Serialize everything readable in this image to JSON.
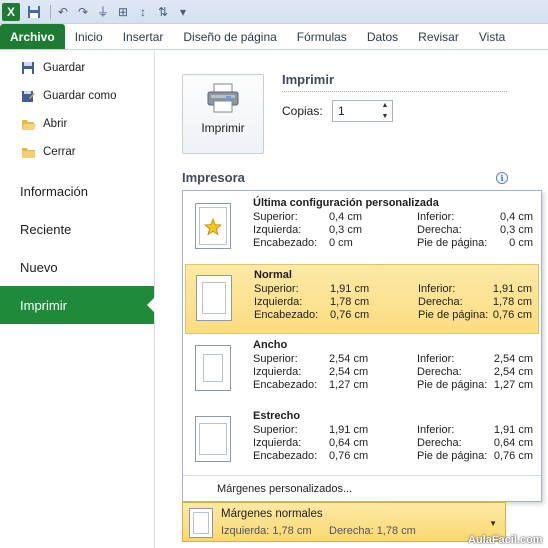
{
  "ribbon": {
    "file_tab": "Archivo",
    "tabs": [
      "Inicio",
      "Insertar",
      "Diseño de página",
      "Fórmulas",
      "Datos",
      "Revisar",
      "Vista"
    ]
  },
  "nav": {
    "commands": [
      {
        "label": "Guardar",
        "icon": "floppy-disk-icon"
      },
      {
        "label": "Guardar como",
        "icon": "save-as-icon"
      },
      {
        "label": "Abrir",
        "icon": "open-folder-icon"
      },
      {
        "label": "Cerrar",
        "icon": "close-folder-icon"
      }
    ],
    "tabs": [
      "Información",
      "Reciente",
      "Nuevo",
      "Imprimir"
    ],
    "active_tab": "Imprimir"
  },
  "print": {
    "button_label": "Imprimir",
    "title": "Imprimir",
    "copies_label": "Copias:",
    "copies_value": "1"
  },
  "printer_section": "Impresora",
  "margins": {
    "options": [
      {
        "name": "Última configuración personalizada",
        "superior": "0,4 cm",
        "inferior": "0,4 cm",
        "izquierda": "0,3 cm",
        "derecha": "0,3 cm",
        "encabezado": "0 cm",
        "pie": "0 cm",
        "selected": false
      },
      {
        "name": "Normal",
        "superior": "1,91 cm",
        "inferior": "1,91 cm",
        "izquierda": "1,78 cm",
        "derecha": "1,78 cm",
        "encabezado": "0,76 cm",
        "pie": "0,76 cm",
        "selected": true
      },
      {
        "name": "Ancho",
        "superior": "2,54 cm",
        "inferior": "2,54 cm",
        "izquierda": "2,54 cm",
        "derecha": "2,54 cm",
        "encabezado": "1,27 cm",
        "pie": "1,27 cm",
        "selected": false
      },
      {
        "name": "Estrecho",
        "superior": "1,91 cm",
        "inferior": "1,91 cm",
        "izquierda": "0,64 cm",
        "derecha": "0,64 cm",
        "encabezado": "0,76 cm",
        "pie": "0,76 cm",
        "selected": false
      }
    ],
    "labels": {
      "superior": "Superior:",
      "inferior": "Inferior:",
      "izquierda": "Izquierda:",
      "derecha": "Derecha:",
      "encabezado": "Encabezado:",
      "pie": "Pie de página:"
    },
    "custom_label": "Márgenes personalizados...",
    "combo": {
      "title": "Márgenes normales",
      "left": "Izquierda:  1,78 cm",
      "right": "Derecha:  1,78 cm"
    }
  },
  "watermark": "AulaFacil.com",
  "colors": {
    "file_tab": "#1e7b34",
    "active_nav": "#1e8a3a",
    "selected_option": "#fbdc80"
  }
}
